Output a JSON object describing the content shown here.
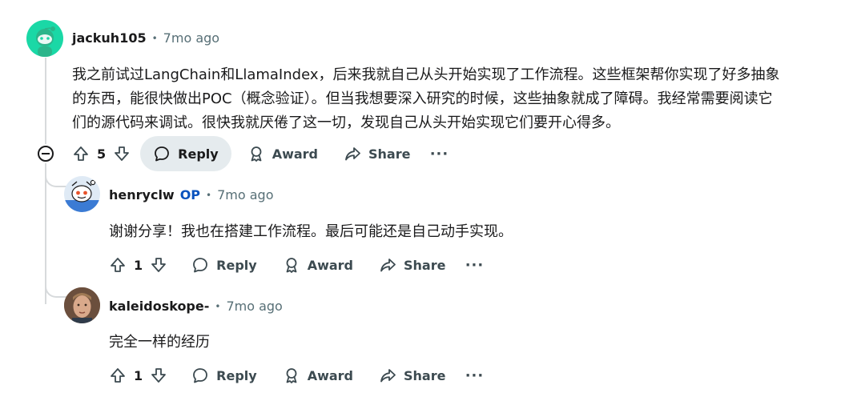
{
  "comments": [
    {
      "author": "jackuh105",
      "dot": "•",
      "time": "7mo ago",
      "lines": [
        "我之前试过LangChain和LlamaIndex，后来我就自己从头开始实现了工作流程。这些框架帮你实现了好多抽象",
        "的东西，能很快做出POC（概念验证）。但当我想要深入研究的时候，这些抽象就成了障碍。我经常需要阅读它",
        "们的源代码来调试。很快我就厌倦了这一切，发现自己从头开始实现它们要开心得多。"
      ],
      "votes": "5",
      "reply_label": "Reply",
      "award_label": "Award",
      "share_label": "Share",
      "more_label": "···"
    },
    {
      "author": "henryclw",
      "op_badge": "OP",
      "dot": "•",
      "time": "7mo ago",
      "lines": [
        "谢谢分享！我也在搭建工作流程。最后可能还是自己动手实现。"
      ],
      "votes": "1",
      "reply_label": "Reply",
      "award_label": "Award",
      "share_label": "Share",
      "more_label": "···"
    },
    {
      "author": "kaleidoskope-",
      "dot": "•",
      "time": "7mo ago",
      "lines": [
        "完全一样的经历"
      ],
      "votes": "1",
      "reply_label": "Reply",
      "award_label": "Award",
      "share_label": "Share",
      "more_label": "···"
    }
  ],
  "colors": {
    "snoo_green": "#1ad8a6",
    "op_blue": "#0a53be",
    "meta_gray": "#576f76",
    "thread_line": "#d7dadc",
    "active_button_bg": "#e5ebee"
  },
  "icons": [
    "upvote-icon",
    "downvote-icon",
    "comment-icon",
    "award-icon",
    "share-icon",
    "collapse-icon"
  ]
}
